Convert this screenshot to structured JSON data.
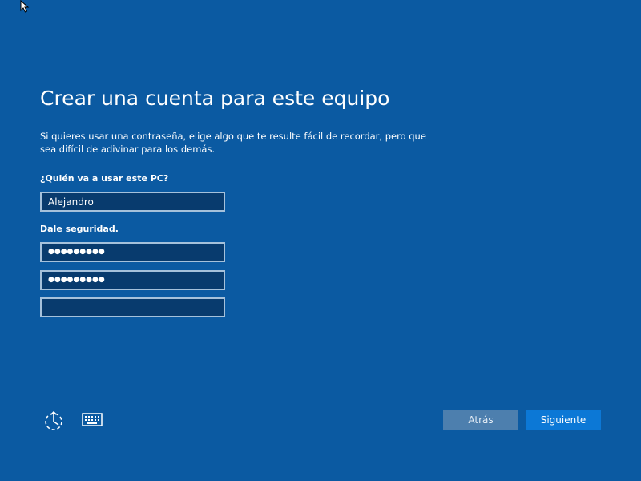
{
  "page": {
    "title": "Crear una cuenta para este equipo",
    "description": "Si quieres usar una contraseña, elige algo que te resulte fácil de recordar, pero que sea difícil de adivinar para los demás."
  },
  "form": {
    "user_label": "¿Quién va a usar este PC?",
    "user_value": "Alejandro",
    "security_label": "Dale seguridad.",
    "password_mask": "●●●●●●●●●",
    "confirm_mask": "●●●●●●●●●",
    "hint_value": ""
  },
  "footer": {
    "back_label": "Atrás",
    "next_label": "Siguiente"
  },
  "icons": {
    "cursor": "mouse-pointer-icon",
    "ease_of_access": "ease-of-access-icon",
    "keyboard": "on-screen-keyboard-icon"
  },
  "colors": {
    "background": "#0b5aa2",
    "field_background": "#083b6e",
    "field_border": "#a5c1db",
    "back_button": "#4d7fae",
    "next_button": "#0c78d6"
  }
}
